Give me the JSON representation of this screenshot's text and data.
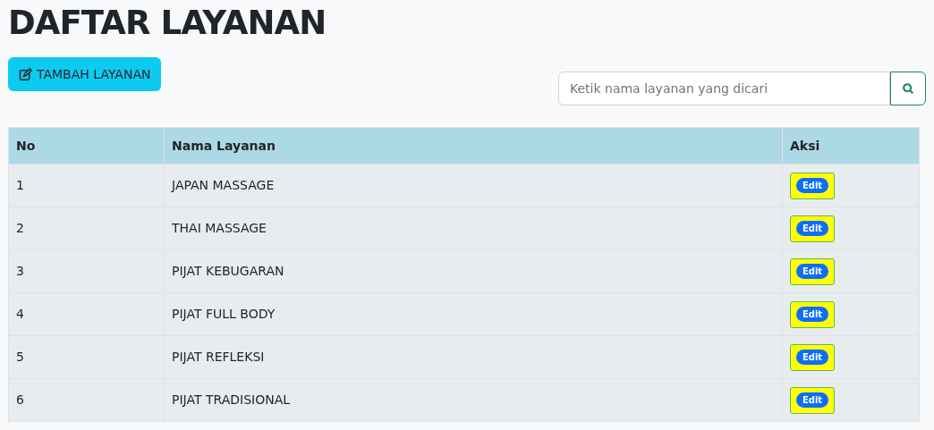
{
  "title": "DAFTAR LAYANAN",
  "add_button": {
    "label": "TAMBAH LAYANAN"
  },
  "search": {
    "placeholder": "Ketik nama layanan yang dicari"
  },
  "table": {
    "columns": [
      "No",
      "Nama Layanan",
      "Aksi"
    ],
    "rows": [
      {
        "no": "1",
        "name": "JAPAN MASSAGE",
        "action": "Edit"
      },
      {
        "no": "2",
        "name": "THAI MASSAGE",
        "action": "Edit"
      },
      {
        "no": "3",
        "name": "PIJAT KEBUGARAN",
        "action": "Edit"
      },
      {
        "no": "4",
        "name": "PIJAT FULL BODY",
        "action": "Edit"
      },
      {
        "no": "5",
        "name": "PIJAT REFLEKSI",
        "action": "Edit"
      },
      {
        "no": "6",
        "name": "PIJAT TRADISIONAL",
        "action": "Edit"
      }
    ]
  }
}
